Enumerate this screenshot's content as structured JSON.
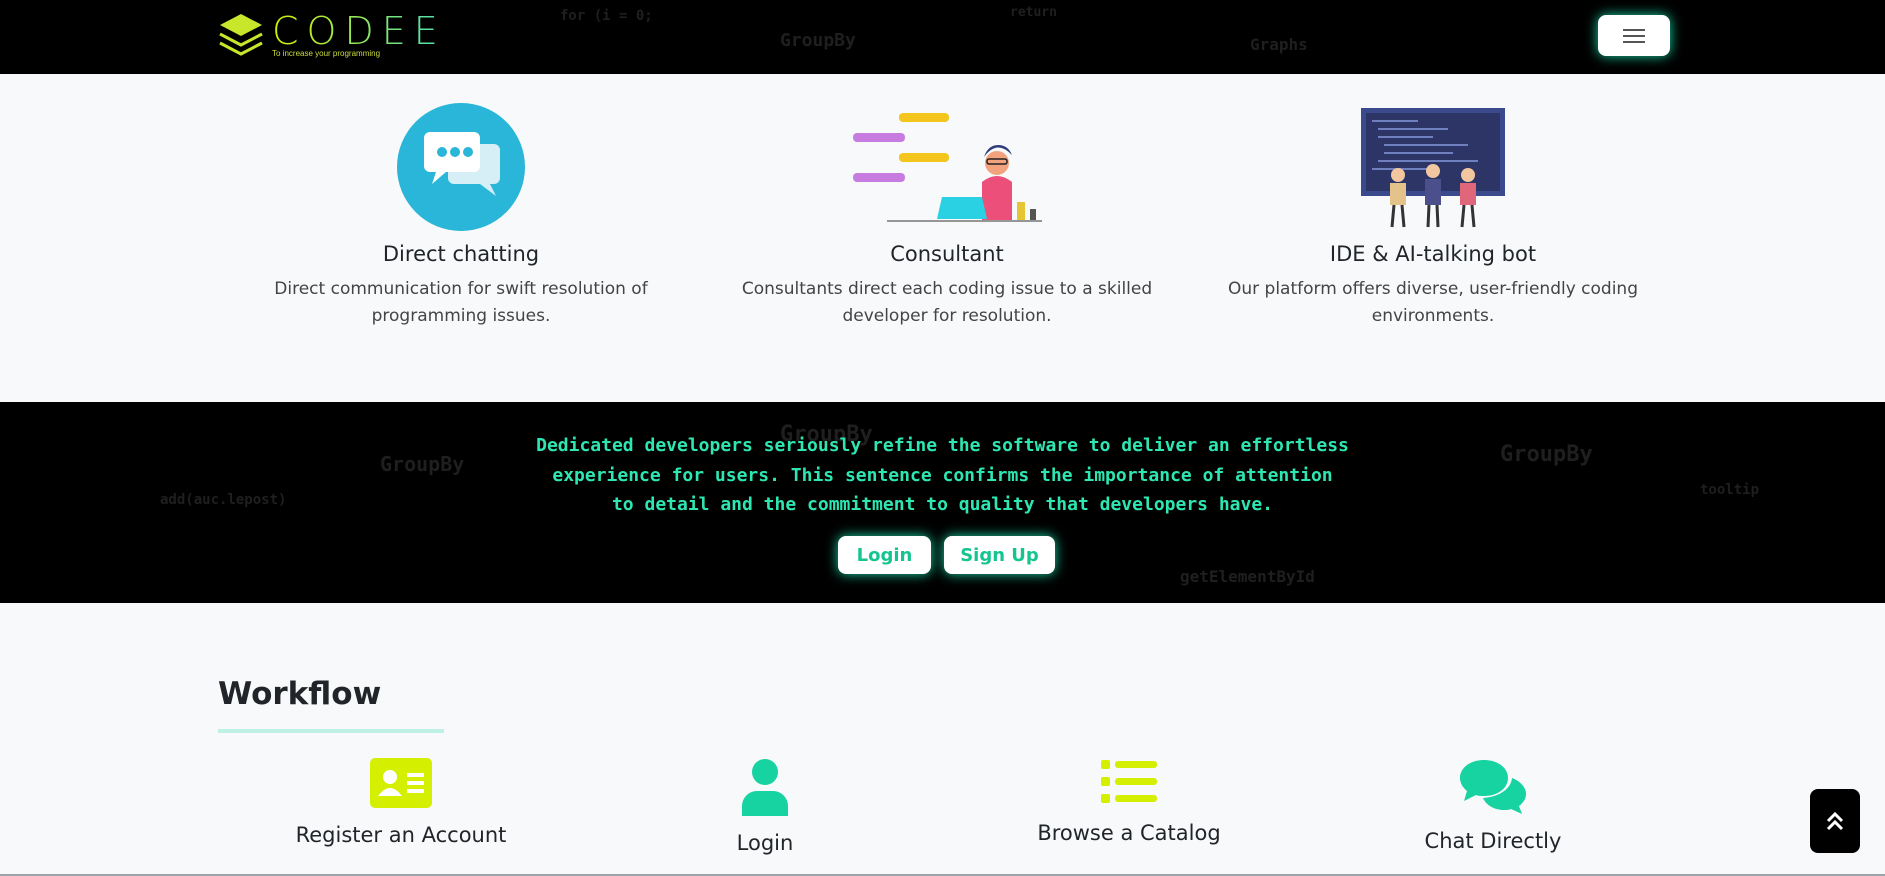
{
  "navbar": {
    "logo_text": "CODEE",
    "tagline": "To increase your programming",
    "menu_icon": "hamburger-icon"
  },
  "features": [
    {
      "icon": "chat-bubbles-icon",
      "title": "Direct chatting",
      "desc_line1": "Direct communication for swift resolution of",
      "desc_line2": "programming issues."
    },
    {
      "icon": "consultant-illustration",
      "title": "Consultant",
      "desc_line1": "Consultants direct each coding issue to a skilled",
      "desc_line2": "developer for resolution."
    },
    {
      "icon": "ide-team-illustration",
      "title": "IDE & AI-talking bot",
      "desc_line1": "Our platform offers diverse, user-friendly coding",
      "desc_line2": "environments."
    }
  ],
  "banner": {
    "line1": "Dedicated developers seriously refine the software to deliver an effortless",
    "line2": "experience for users. This sentence confirms the importance of attention",
    "line3": "to detail and the commitment to quality that developers have.",
    "login_label": "Login",
    "signup_label": "Sign Up"
  },
  "workflow": {
    "title": "Workflow",
    "steps": [
      {
        "icon": "id-card-icon",
        "label": "Register an Account"
      },
      {
        "icon": "user-icon",
        "label": "Login"
      },
      {
        "icon": "list-icon",
        "label": "Browse a Catalog"
      },
      {
        "icon": "comments-icon",
        "label": "Chat Directly"
      }
    ]
  },
  "scroll_top_icon": "double-chevron-up-icon",
  "colors": {
    "accent": "#19d6a3",
    "lime": "#d4ef00",
    "banner_text": "#2ee6b2"
  }
}
